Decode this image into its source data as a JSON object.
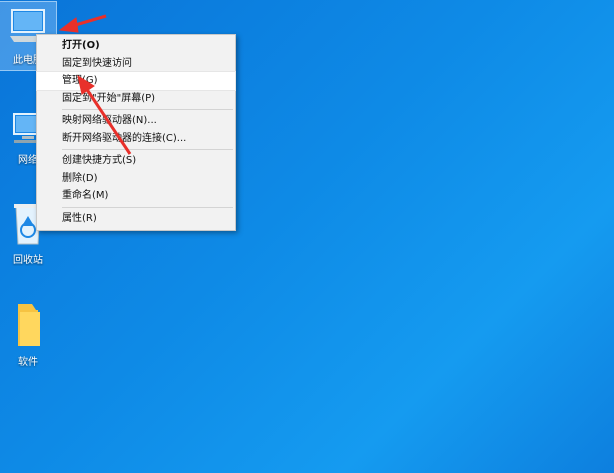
{
  "desktop": {
    "icons": [
      {
        "label": "此电脑",
        "icon": "this-pc-icon"
      },
      {
        "label": "网络",
        "icon": "network-icon"
      },
      {
        "label": "回收站",
        "icon": "recycle-bin-icon"
      },
      {
        "label": "软件",
        "icon": "folder-icon"
      }
    ]
  },
  "context_menu": {
    "items": [
      {
        "label": "打开(O)"
      },
      {
        "label": "固定到快速访问"
      },
      {
        "label": "管理(G)"
      },
      {
        "label": "固定到\"开始\"屏幕(P)"
      },
      {
        "label": "映射网络驱动器(N)..."
      },
      {
        "label": "断开网络驱动器的连接(C)..."
      },
      {
        "label": "创建快捷方式(S)"
      },
      {
        "label": "删除(D)"
      },
      {
        "label": "重命名(M)"
      },
      {
        "label": "属性(R)"
      }
    ]
  },
  "colors": {
    "desktop_bg": "#0e8ae6",
    "annotation_arrow": "#e8302a",
    "menu_bg": "#f2f2f2"
  }
}
